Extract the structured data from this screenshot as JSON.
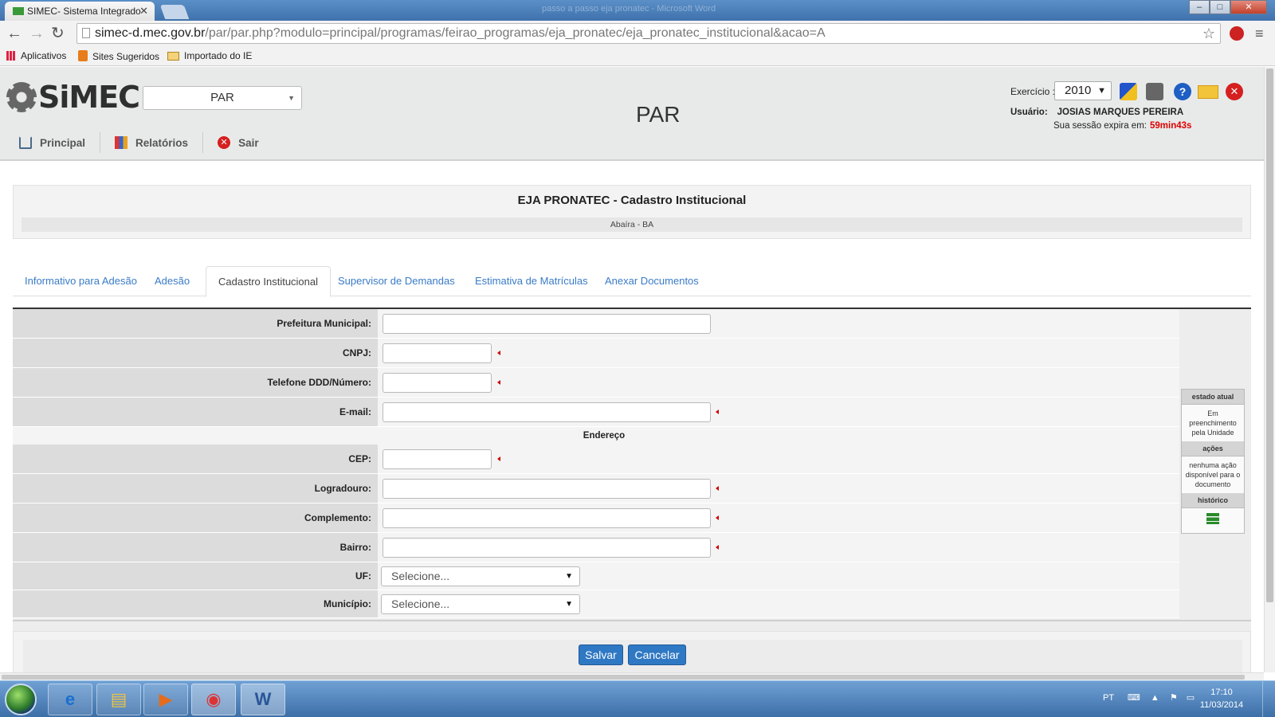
{
  "browser": {
    "tab_title": "SIMEC- Sistema Integrado",
    "window_title": "passo a passo eja pronatec - Microsoft Word",
    "url_host": "simec-d.mec.gov.br",
    "url_path": "/par/par.php?modulo=principal/programas/feirao_programas/eja_pronatec/eja_pronatec_institucional&acao=A",
    "bookmarks": [
      "Aplicativos",
      "Sites Sugeridos",
      "Importado do IE"
    ]
  },
  "header": {
    "logo_text": "SiMEC",
    "system_select": "PAR",
    "page_title": "PAR",
    "exercicio_label": "Exercício :",
    "exercicio_value": "2010",
    "usuario_label": "Usuário:",
    "usuario_name": "JOSIAS MARQUES PEREIRA",
    "session_label": "Sua sessão expira em:",
    "session_time": "59min43s"
  },
  "menu": {
    "items": [
      "Principal",
      "Relatórios",
      "Sair"
    ]
  },
  "titlebox": {
    "title": "EJA PRONATEC - Cadastro Institucional",
    "subtitle": "Abaíra - BA"
  },
  "tabs": [
    "Informativo para Adesão",
    "Adesão",
    "Cadastro Institucional",
    "Supervisor de Demandas",
    "Estimativa de Matrículas",
    "Anexar Documentos"
  ],
  "form": {
    "prefeitura_label": "Prefeitura Municipal:",
    "cnpj_label": "CNPJ:",
    "telefone_label": "Telefone DDD/Número:",
    "email_label": "E-mail:",
    "endereco_section": "Endereço",
    "cep_label": "CEP:",
    "logradouro_label": "Logradouro:",
    "complemento_label": "Complemento:",
    "bairro_label": "Bairro:",
    "uf_label": "UF:",
    "uf_value": "Selecione...",
    "municipio_label": "Município:",
    "municipio_value": "Selecione..."
  },
  "workflow": {
    "estado_header": "estado atual",
    "estado_value": "Em preenchimento pela Unidade",
    "acoes_header": "ações",
    "acoes_value": "nenhuma ação disponível para o documento",
    "historico_header": "histórico"
  },
  "buttons": {
    "save": "Salvar",
    "cancel": "Cancelar"
  },
  "taskbar": {
    "tray_lang": "PT",
    "time": "17:10",
    "date": "11/03/2014"
  }
}
